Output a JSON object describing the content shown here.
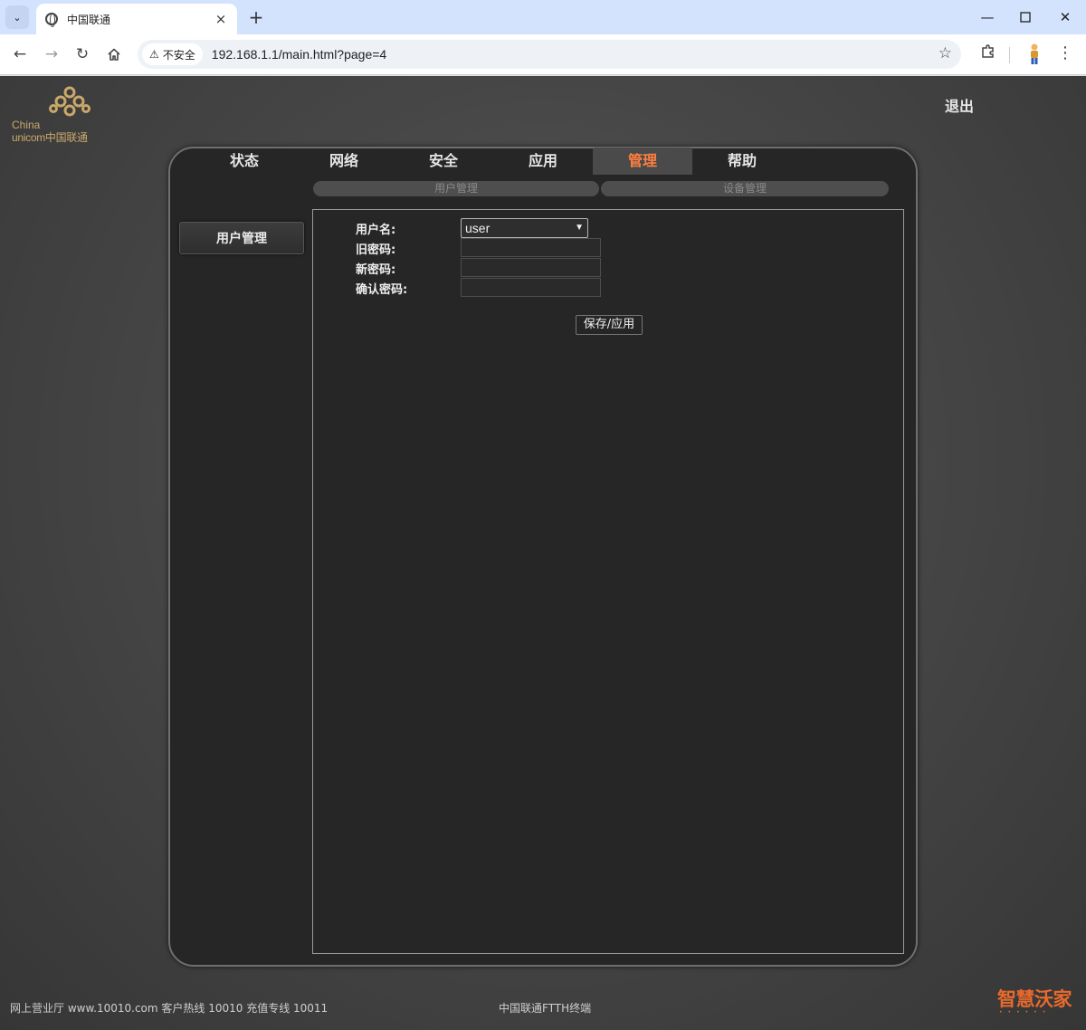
{
  "browser": {
    "tab_title": "中国联通",
    "tab_close": "×",
    "new_tab": "+",
    "security_label": "不安全",
    "url": "192.168.1.1/main.html?page=4",
    "icons": [
      "tab-list-icon",
      "globe-icon",
      "close-icon",
      "back-icon",
      "forward-icon",
      "reload-icon",
      "home-icon",
      "warning-icon",
      "star-icon",
      "extensions-icon",
      "profile-icon",
      "menu-icon",
      "minimize-icon",
      "maximize-icon",
      "window-close-icon"
    ]
  },
  "header": {
    "logo_text_line1": "China",
    "logo_text_line2": "unicom中国联通",
    "logout": "退出"
  },
  "main_nav": [
    {
      "label": "状态",
      "active": false
    },
    {
      "label": "网络",
      "active": false
    },
    {
      "label": "安全",
      "active": false
    },
    {
      "label": "应用",
      "active": false
    },
    {
      "label": "管理",
      "active": true
    },
    {
      "label": "帮助",
      "active": false
    }
  ],
  "sub_nav": [
    {
      "label": "用户管理"
    },
    {
      "label": "设备管理"
    }
  ],
  "sidebar": {
    "item": "用户管理"
  },
  "form": {
    "username_label": "用户名:",
    "username_value": "user",
    "old_password_label": "旧密码:",
    "new_password_label": "新密码:",
    "confirm_password_label": "确认密码:",
    "save_button": "保存/应用"
  },
  "footer": {
    "left": "网上营业厅 www.10010.com 客户热线 10010 充值专线 10011",
    "center": "中国联通FTTH终端",
    "brand": "智慧沃家"
  },
  "colors": {
    "accent": "#ff7f41",
    "brand": "#e86a2c",
    "logo": "#c9a86a"
  }
}
